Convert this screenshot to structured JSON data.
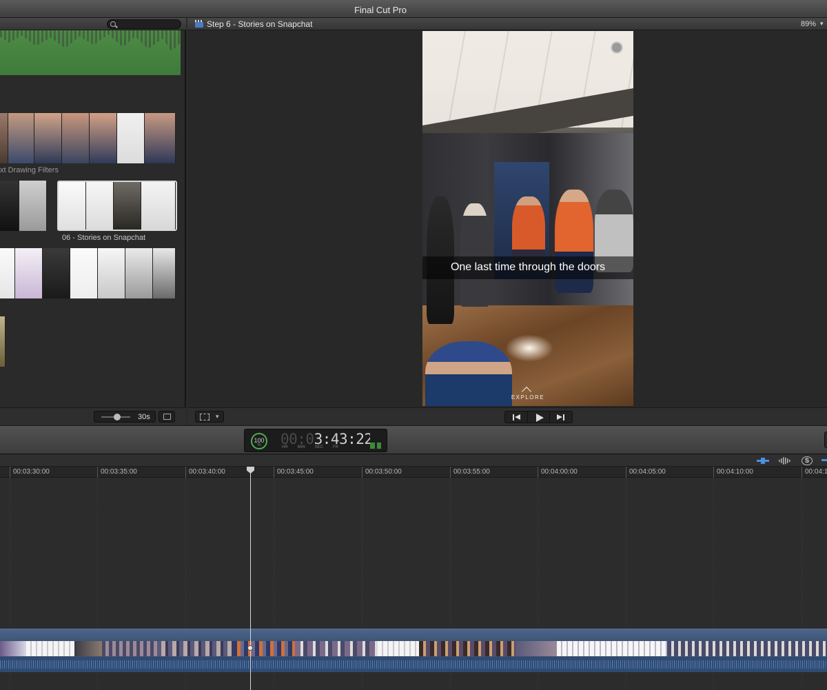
{
  "window": {
    "title": "Final Cut Pro"
  },
  "browser": {
    "search": {
      "value": "",
      "placeholder": ""
    },
    "clips": [
      {
        "label": ""
      },
      {
        "label": "xt Drawing Filters"
      },
      {
        "label": "06 - Stories on Snapchat"
      },
      {
        "label": ""
      },
      {
        "label": ""
      }
    ],
    "duration_label": "30s"
  },
  "viewer": {
    "title": "Step 6 - Stories on Snapchat",
    "zoom": "89%",
    "zoom_caret": "▾",
    "caption": "One last time through the doors",
    "explore_label": "EXPLORE"
  },
  "dashboard": {
    "progress": "100",
    "progress_unit": "%",
    "timecode_dim": "00:0",
    "timecode": "3:43:22",
    "timecode_units": [
      "HR",
      "MIN",
      "SEC",
      "FR"
    ]
  },
  "timeline": {
    "ruler": [
      "00:03:30:00",
      "00:03:35:00",
      "00:03:40:00",
      "00:03:45:00",
      "00:03:50:00",
      "00:03:55:00",
      "00:04:00:00",
      "00:04:05:00",
      "00:04:10:00",
      "00:04:1"
    ],
    "solo_label": "S"
  },
  "colors": {
    "accent_blue": "#4f8ee0",
    "storyline": "#3b5272",
    "progress_green": "#4caf50"
  }
}
